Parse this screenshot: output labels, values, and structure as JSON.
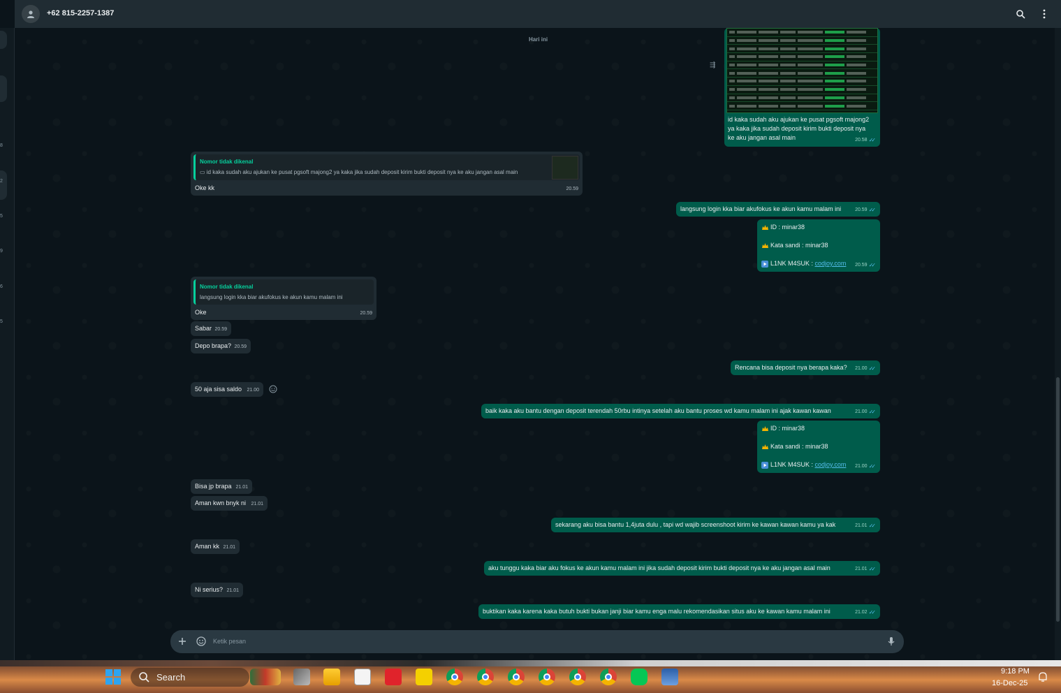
{
  "header": {
    "contact": "+62 815-2257-1387",
    "icons": [
      "avatar-person-icon",
      "search-icon",
      "more-vertical-icon"
    ]
  },
  "left_rail": {
    "numbers": [
      "8",
      "2",
      "5",
      "9",
      "6",
      "5"
    ]
  },
  "chat": {
    "date_chip": "Hari ini",
    "forwarded_image": {
      "caption": "id kaka sudah aku ajukan ke pusat pgsoft majong2 ya kaka jika sudah deposit kirim bukti deposit nya ke aku jangan asal main",
      "caption_lines": [
        "id kaka sudah aku ajukan ke pusat pgsoft majong2",
        "ya kaka jika sudah deposit kirim bukti deposit nya",
        "ke aku jangan asal main"
      ],
      "time": "20.58"
    },
    "m1": {
      "quote_name": "Nomor tidak dikenal",
      "quote_text": "id kaka sudah aku ajukan ke pusat pgsoft majong2 ya kaka jika sudah deposit kirim bukti deposit nya ke aku jangan asal main",
      "text": "Oke kk",
      "time": "20.59"
    },
    "m2": {
      "text": "langsung login kka biar akufokus ke akun kamu malam ini",
      "time": "20.59"
    },
    "m3": {
      "id_line": "ID :  minar38",
      "pass_line": "Kata sandi : minar38",
      "link_prefix": "L1NK M4SUK : ",
      "link": "codjoy.com",
      "time": "20.59"
    },
    "m4": {
      "quote_name": "Nomor tidak dikenal",
      "quote_text": "langsung login kka biar akufokus ke akun kamu malam ini",
      "text": "Oke",
      "time": "20.59"
    },
    "m5": {
      "text": "Sabar",
      "time": "20.59"
    },
    "m6": {
      "text": "Depo brapa?",
      "time": "20.59"
    },
    "m7": {
      "text": "Rencana bisa deposit nya berapa kaka?",
      "time": "21.00"
    },
    "m8": {
      "text": "50 aja sisa saldo",
      "time": "21.00"
    },
    "m9": {
      "text": "baik kaka aku bantu dengan deposit terendah 50rbu intinya setelah aku bantu proses wd kamu malam ini ajak kawan kawan",
      "time": "21.00"
    },
    "m10": {
      "id_line": "ID :  minar38",
      "pass_line": "Kata sandi : minar38",
      "link_prefix": "L1NK M4SUK : ",
      "link": "codjoy.com",
      "time": "21.00"
    },
    "m11": {
      "text": "Bisa jp brapa",
      "time": "21.01"
    },
    "m12": {
      "text": "Aman kwn bnyk ni",
      "time": "21.01"
    },
    "m13": {
      "text": "sekarang aku bisa bantu 1,4juta dulu , tapi wd wajib screenshoot kirim ke kawan kawan kamu ya kak",
      "time": "21.01"
    },
    "m14": {
      "text": "Aman kk",
      "time": "21.01"
    },
    "m15": {
      "text": "aku tunggu kaka biar aku fokus ke akun kamu malam ini jika sudah deposit kirim bukti deposit nya ke aku jangan asal main",
      "time": "21.01"
    },
    "m16": {
      "text": "Ni serius?",
      "time": "21.01"
    },
    "m17": {
      "text": "buktikan kaka karena kaka butuh bukti bukan janji biar kamu enga malu rekomendasikan situs aku ke kawan kamu malam ini",
      "time": "21.02"
    }
  },
  "composer": {
    "placeholder": "Ketik pesan"
  },
  "taskbar": {
    "search_label": "Search",
    "time": "9:18 PM",
    "date": "16-Dec-25"
  },
  "colors": {
    "incoming": "#202c33",
    "outgoing": "#005c4b",
    "accent": "#06cf9c",
    "read_tick": "#53bdeb"
  }
}
